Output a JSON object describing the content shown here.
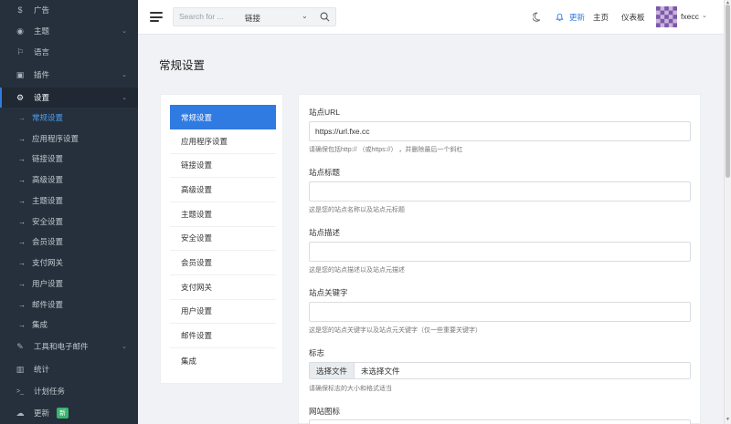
{
  "sidebar": {
    "items": [
      {
        "label": "广告",
        "icon": "dollar-icon",
        "glyph": "$"
      },
      {
        "label": "主题",
        "icon": "eye-icon",
        "glyph": "◉",
        "chevron": "⌄"
      },
      {
        "label": "语言",
        "icon": "flag-icon",
        "glyph": "⚐"
      },
      {
        "label": "插件",
        "icon": "puzzle-icon",
        "glyph": "▣",
        "chevron": "⌄"
      },
      {
        "label": "设置",
        "icon": "gear-icon",
        "glyph": "⚙",
        "chevron": "⌄"
      }
    ],
    "subitems": [
      "常规设置",
      "应用程序设置",
      "链接设置",
      "高级设置",
      "主题设置",
      "安全设置",
      "会员设置",
      "支付网关",
      "用户设置",
      "邮件设置",
      "集成"
    ],
    "bottom": [
      {
        "label": "工具和电子邮件",
        "icon": "wrench-icon",
        "glyph": "🔧",
        "chevron": "⌄"
      },
      {
        "label": "统计",
        "icon": "bar-chart-icon",
        "glyph": "▥"
      },
      {
        "label": "计划任务",
        "icon": "terminal-icon",
        "glyph": ">_"
      },
      {
        "label": "更新",
        "icon": "cloud-icon",
        "glyph": "☁",
        "badge": "新"
      }
    ]
  },
  "topbar": {
    "search_placeholder": "Search for ...",
    "search_scope": "链接",
    "update_label": "更新",
    "home_label": "主页",
    "dashboard_label": "仪表板",
    "username": "fxecc"
  },
  "main": {
    "page_title": "常规设置",
    "nav": [
      "常规设置",
      "应用程序设置",
      "链接设置",
      "高级设置",
      "主题设置",
      "安全设置",
      "会员设置",
      "支付网关",
      "用户设置",
      "邮件设置",
      "集成"
    ],
    "fields": {
      "site_url_label": "站点URL",
      "site_url_value": "https://url.fxe.cc",
      "site_url_help": "请确保包括http:// （或https://） ，并删除最后一个斜杠",
      "site_title_label": "站点标题",
      "site_title_help": "这是您的站点名称以及站点元标题",
      "site_desc_label": "站点描述",
      "site_desc_help": "这是您的站点描述以及站点元描述",
      "site_keywords_label": "站点关键字",
      "site_keywords_help": "这是您的站点关键字以及站点元关键字（仅一些重要关键字）",
      "logo_label": "标志",
      "logo_button": "选择文件",
      "logo_status": "未选择文件",
      "logo_help": "请确保标志的大小和格式适当",
      "favicon_label": "网站图标"
    }
  },
  "colors": {
    "sidebar_bg": "#25303c",
    "accent": "#2f7be2",
    "badge": "#3cb371"
  }
}
